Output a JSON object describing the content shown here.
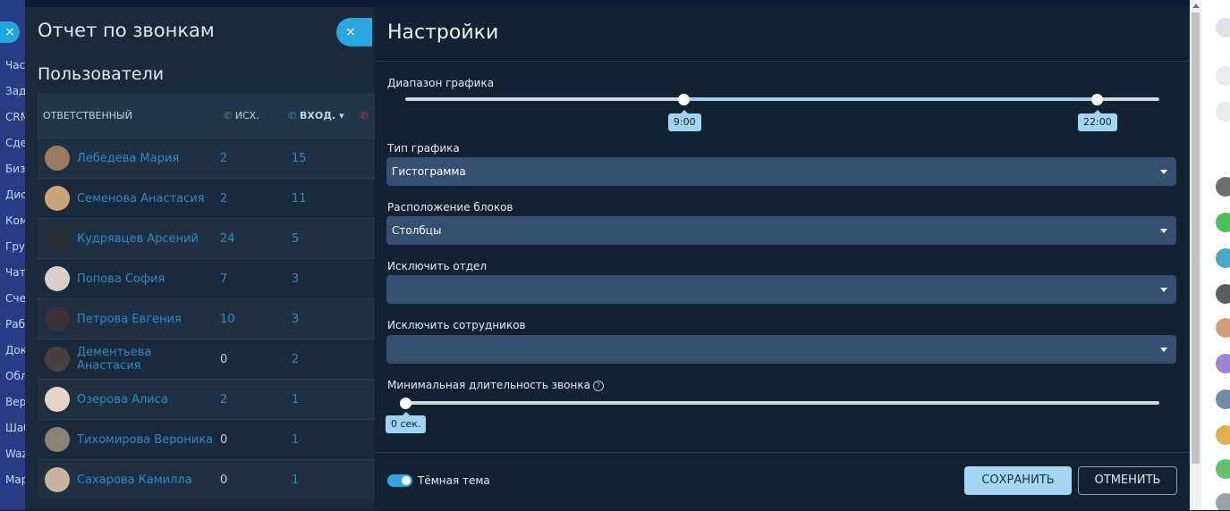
{
  "left_nav": {
    "close_icon": "×",
    "items": [
      "Част",
      "Зада",
      "CRM",
      "Сдел",
      "Бизн",
      "Диск",
      "Комп",
      "Груп",
      "Чат и",
      "Счет",
      "Рабо",
      "Доку",
      "Обла",
      "Верс",
      "Шаб",
      "Wazz",
      "Мар"
    ]
  },
  "report": {
    "title": "Отчет по звонкам",
    "close_icon": "×",
    "subtitle": "Пользователи",
    "columns": [
      "ОТВЕТСТВЕННЫЙ",
      "ИСХ.",
      "ВХОД."
    ],
    "rows": [
      {
        "name": "Лебедева Мария",
        "out": "2",
        "in": "15"
      },
      {
        "name": "Семенова Анастасия",
        "out": "2",
        "in": "11"
      },
      {
        "name": "Кудрявцев Арсений",
        "out": "24",
        "in": "5"
      },
      {
        "name": "Попова София",
        "out": "7",
        "in": "3"
      },
      {
        "name": "Петрова Евгения",
        "out": "10",
        "in": "3"
      },
      {
        "name": "Дементьева Анастасия",
        "out": "0",
        "in": "2"
      },
      {
        "name": "Озерова Алиса",
        "out": "2",
        "in": "1"
      },
      {
        "name": "Тихомирова Вероника",
        "out": "0",
        "in": "1"
      },
      {
        "name": "Сахарова Камилла",
        "out": "0",
        "in": "1"
      }
    ]
  },
  "settings": {
    "title": "Настройки",
    "range": {
      "label": "Диапазон графика",
      "from": "9:00",
      "to": "22:00",
      "from_fraction": 0.37,
      "to_fraction": 0.917
    },
    "chart_type": {
      "label": "Тип графика",
      "value": "Гистограмма"
    },
    "blocks_layout": {
      "label": "Расположение блоков",
      "value": "Столбцы"
    },
    "exclude_department": {
      "label": "Исключить отдел",
      "value": ""
    },
    "exclude_employees": {
      "label": "Исключить сотрудников",
      "value": ""
    },
    "min_duration": {
      "label": "Минимальная длительность звонка",
      "help_icon": "?",
      "value": "0 сек.",
      "fraction": 0
    },
    "dark_theme": {
      "label": "Тёмная тема",
      "on": true
    },
    "save_label": "СОХРАНИТЬ",
    "cancel_label": "ОТМЕНИТЬ"
  },
  "colors": {
    "accent": "#2aa6e0",
    "panel_bg": "#132233",
    "select_bg": "#35506e",
    "bubble": "#9fd4f4"
  }
}
